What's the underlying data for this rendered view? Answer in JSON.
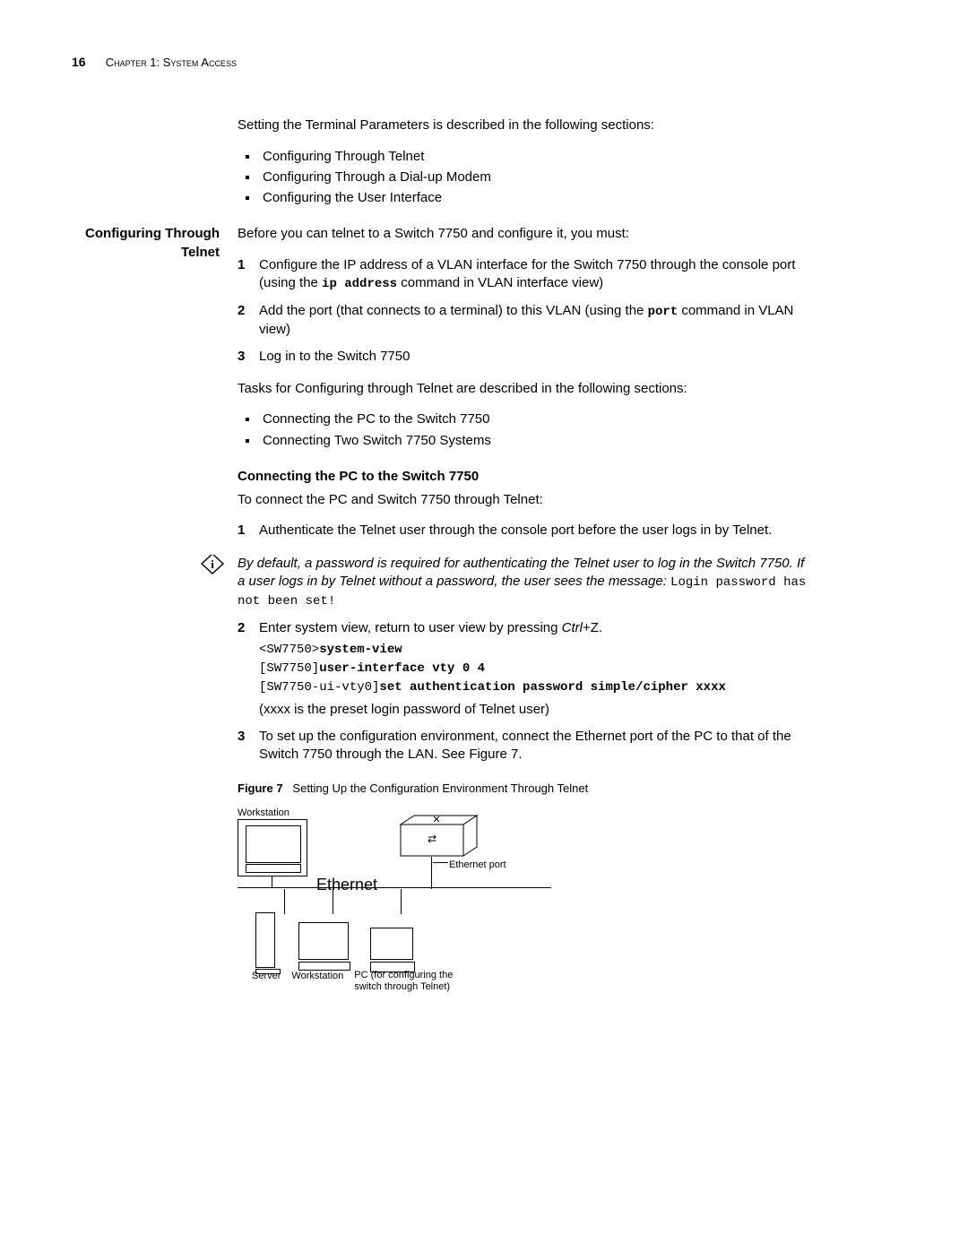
{
  "page_number": "16",
  "chapter_header": "Chapter 1: System Access",
  "intro_p": "Setting the Terminal Parameters is described in the following sections:",
  "intro_bullets": [
    "Configuring Through Telnet",
    "Configuring Through a Dial-up Modem",
    "Configuring the User Interface"
  ],
  "section_heading": "Configuring Through Telnet",
  "telnet_intro": "Before you can telnet to a Switch 7750 and configure it, you must:",
  "prereq_steps": {
    "s1_a": "Configure the IP address of a VLAN interface for the Switch 7750 through the console port (using the ",
    "s1_code": "ip address",
    "s1_b": " command in VLAN interface view)",
    "s2_a": "Add the port (that connects to a terminal) to this VLAN (using the ",
    "s2_code": "port",
    "s2_b": " command in VLAN view)",
    "s3": "Log in to the Switch 7750"
  },
  "tasks_p": "Tasks for Configuring through Telnet are described in the following sections:",
  "task_bullets": [
    "Connecting the PC to the Switch 7750",
    "Connecting Two Switch 7750 Systems"
  ],
  "conn_heading": "Connecting the PC to the Switch 7750",
  "conn_intro": "To connect the PC and Switch 7750 through Telnet:",
  "conn_step1": "Authenticate the Telnet user through the console port before the user logs in by Telnet.",
  "note": {
    "a": "By default, a password is required for authenticating the Telnet user to log in the Switch 7750. If a user logs in by Telnet without a password, the user sees the message: ",
    "code": "Login password has not been set!"
  },
  "conn_step2": {
    "a": "Enter system view, return to user view by pressing ",
    "key": "Ctrl",
    "b": "+Z."
  },
  "code_block": {
    "l1a": "<SW7750>",
    "l1b": "system-view",
    "l2a": "[SW7750]",
    "l2b": "user-interface vty 0 4",
    "l3a": "[SW7750-ui-vty0]",
    "l3b": "set authentication password simple/cipher xxxx"
  },
  "code_note": "(xxxx is the preset login password of Telnet user)",
  "conn_step3": "To set up the configuration environment, connect the Ethernet port of the PC to that of the Switch 7750 through the LAN. See Figure 7.",
  "figure": {
    "label_bold": "Figure 7",
    "caption": "Setting Up the Configuration Environment Through Telnet",
    "workstation_top": "Workstation",
    "ethernet": "Ethernet",
    "ethernet_port": "Ethernet port",
    "server": "Server",
    "workstation_bottom": "Workstation",
    "pc_label": "PC (for configuring the switch through Telnet)"
  }
}
